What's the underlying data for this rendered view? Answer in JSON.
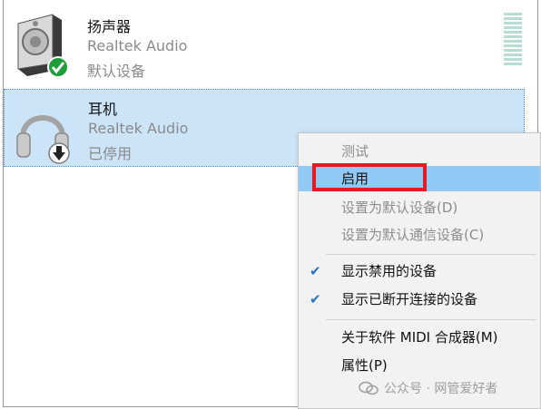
{
  "devices": [
    {
      "name": "扬声器",
      "driver": "Realtek Audio",
      "status": "默认设备",
      "icon": "speaker-icon",
      "badge": "default-check-icon"
    },
    {
      "name": "耳机",
      "driver": "Realtek Audio",
      "status": "已停用",
      "icon": "headphones-icon",
      "badge": "disabled-arrow-icon"
    }
  ],
  "context_menu": {
    "items": [
      {
        "label": "测试",
        "state": "disabled",
        "checked": false
      },
      {
        "label": "启用",
        "state": "highlighted",
        "checked": false
      },
      {
        "label": "设置为默认设备(D)",
        "state": "disabled",
        "checked": false
      },
      {
        "label": "设置为默认通信设备(C)",
        "state": "disabled",
        "checked": false
      },
      {
        "label": "显示禁用的设备",
        "state": "enabled",
        "checked": true
      },
      {
        "label": "显示已断开连接的设备",
        "state": "enabled",
        "checked": true
      },
      {
        "label": "关于软件 MIDI 合成器(M)",
        "state": "enabled",
        "checked": false
      },
      {
        "label": "属性(P)",
        "state": "enabled",
        "checked": false
      }
    ],
    "check_glyph": "✔"
  },
  "watermark": {
    "text": "公众号 · 网管爱好者"
  },
  "colors": {
    "selection_bg": "#cce4f7",
    "menu_highlight": "#91c9f7",
    "annotation_box": "#e41b23",
    "check_green": "#1e9e3a"
  }
}
